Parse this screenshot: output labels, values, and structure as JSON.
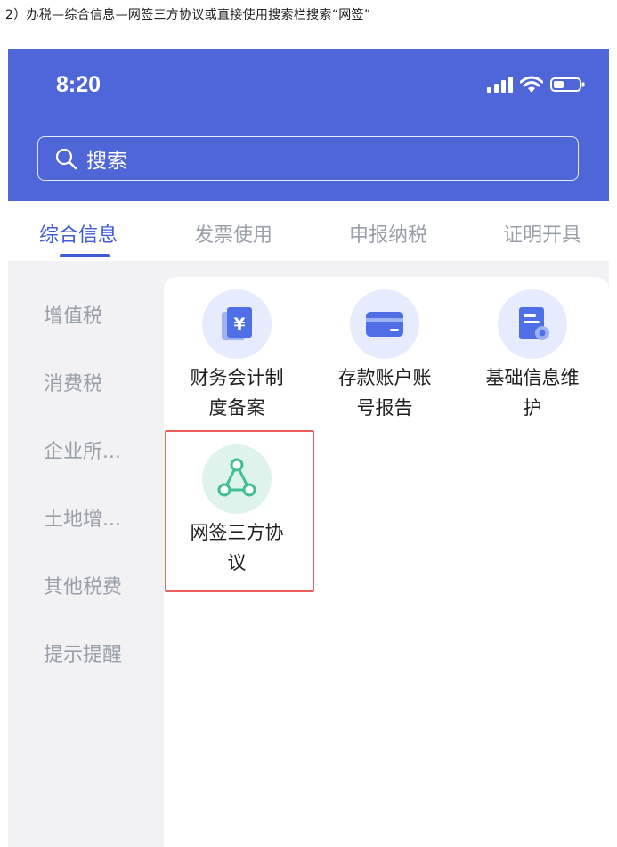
{
  "caption": "2）办税—综合信息—网签三方协议或直接使用搜索栏搜索“网签”",
  "status_bar": {
    "time": "8:20"
  },
  "search": {
    "placeholder": "搜索"
  },
  "tabs": [
    {
      "label": "综合信息",
      "active": true
    },
    {
      "label": "发票使用",
      "active": false
    },
    {
      "label": "申报纳税",
      "active": false
    },
    {
      "label": "证明开具",
      "active": false
    }
  ],
  "sidebar": {
    "items": [
      {
        "label": "增值税"
      },
      {
        "label": "消费税"
      },
      {
        "label": "企业所..."
      },
      {
        "label": "土地增..."
      },
      {
        "label": "其他税费"
      },
      {
        "label": "提示提醒"
      }
    ]
  },
  "services": [
    {
      "line1": "财务会计制",
      "line2": "度备案",
      "icon": "finance-filing-icon"
    },
    {
      "line1": "存款账户账",
      "line2": "号报告",
      "icon": "bank-card-icon"
    },
    {
      "line1": "基础信息维",
      "line2": "护",
      "icon": "info-maintenance-icon"
    },
    {
      "line1": "网签三方协",
      "line2": "议",
      "icon": "tripartite-agreement-icon"
    }
  ],
  "colors": {
    "header_bg": "#4f66d8",
    "accent": "#3f5bd6",
    "highlight_border": "#ec5d5d",
    "green_icon": "#3fbf93"
  }
}
